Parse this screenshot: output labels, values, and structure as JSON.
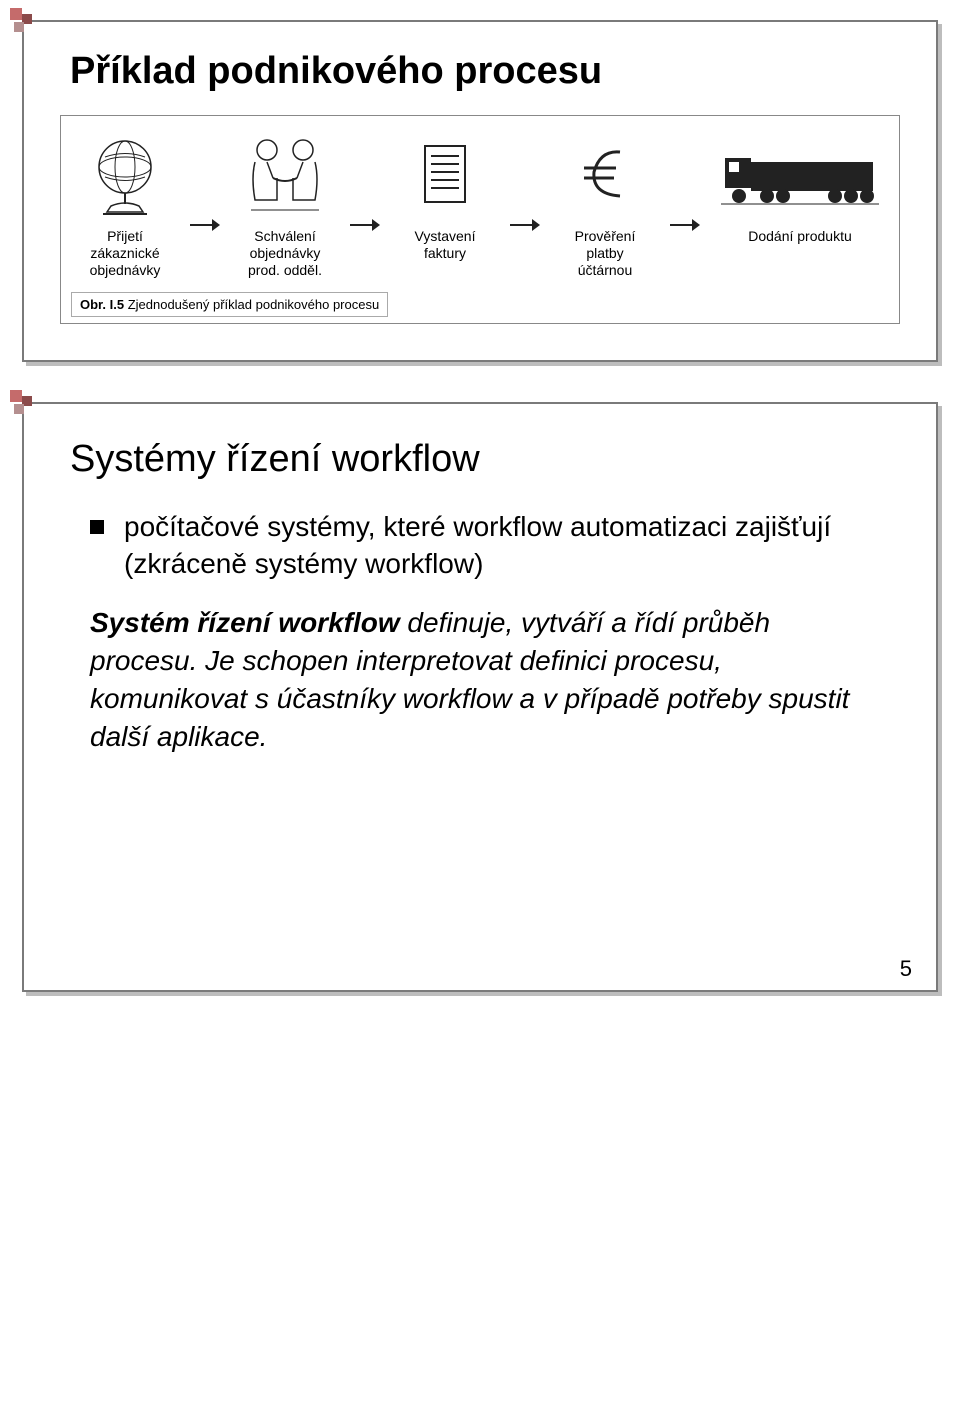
{
  "slide1": {
    "title": "Příklad podnikového procesu",
    "steps": [
      {
        "name": "step-1",
        "caption": "Přijetí\nzákaznické\nobjednávky"
      },
      {
        "name": "step-2",
        "caption": "Schválení\nobjednávky\nprod. odděl."
      },
      {
        "name": "step-3",
        "caption": "Vystavení\nfaktury"
      },
      {
        "name": "step-4",
        "caption": "Prověření\nplatby\núčtárnou"
      },
      {
        "name": "step-5",
        "caption": "Dodání produktu"
      }
    ],
    "figure_label": "Obr. I.5",
    "figure_caption": "Zjednodušený příklad podnikového procesu"
  },
  "slide2": {
    "title": "Systémy řízení workflow",
    "bullet": "počítačové systémy, které workflow automatizaci zajišťují (zkráceně systémy workflow)",
    "definition_lead": "Systém řízení workflow",
    "definition_body": " definuje, vytváří a řídí průběh procesu. Je schopen interpretovat definici procesu, komunikovat s účastníky workflow a v případě potřeby spustit další aplikace."
  },
  "page_number": "5"
}
